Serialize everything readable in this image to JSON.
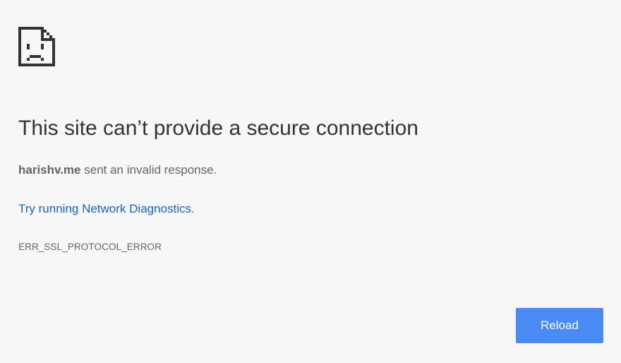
{
  "error_page": {
    "icon": "sad-page-icon",
    "title": "This site can’t provide a secure connection",
    "summary": {
      "host": "harishv.me",
      "rest": " sent an invalid response."
    },
    "suggestion": {
      "link_text": "Try running Network Diagnostics",
      "trailing": "."
    },
    "error_code": "ERR_SSL_PROTOCOL_ERROR",
    "reload_label": "Reload"
  },
  "colors": {
    "background": "#f7f7f7",
    "title": "#333333",
    "body_text": "#646464",
    "link": "#1a5fd1",
    "button": "#4a8af4"
  }
}
